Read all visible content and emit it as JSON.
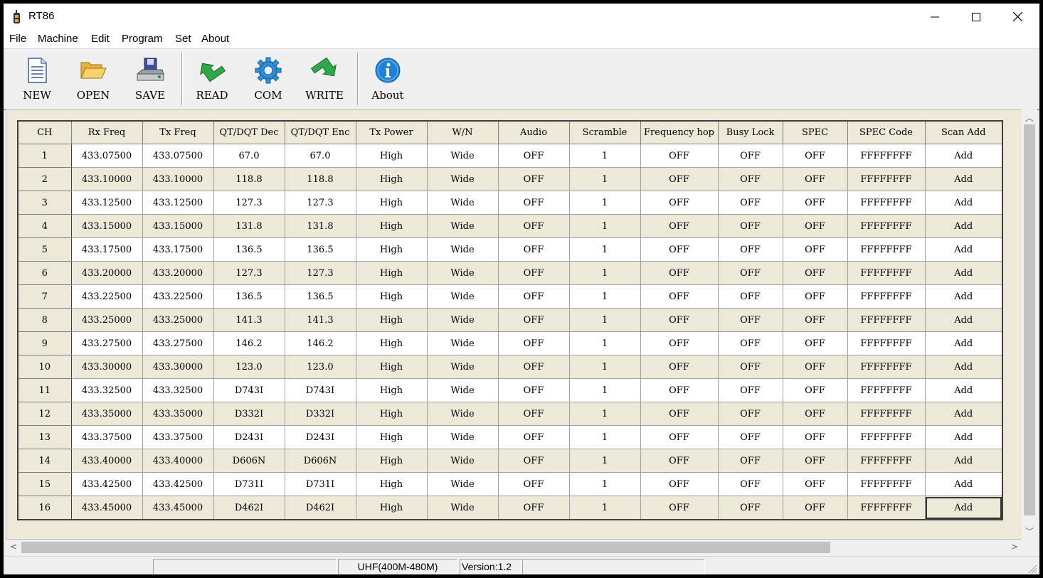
{
  "window": {
    "title": "RT86"
  },
  "menu": [
    "File",
    "Machine",
    "Edit",
    "Program",
    "Set",
    "About"
  ],
  "toolbar": [
    {
      "label": "NEW",
      "icon": "new-document-icon"
    },
    {
      "label": "OPEN",
      "icon": "open-folder-icon"
    },
    {
      "label": "SAVE",
      "icon": "save-disk-icon"
    },
    {
      "label": "READ",
      "icon": "read-arrow-icon"
    },
    {
      "label": "COM",
      "icon": "com-gear-icon"
    },
    {
      "label": "WRITE",
      "icon": "write-arrow-icon"
    },
    {
      "label": "About",
      "icon": "info-icon"
    }
  ],
  "table": {
    "columns": [
      "CH",
      "Rx Freq",
      "Tx Freq",
      "QT/DQT Dec",
      "QT/DQT Enc",
      "Tx Power",
      "W/N",
      "Audio",
      "Scramble",
      "Frequency hop",
      "Busy Lock",
      "SPEC",
      "SPEC Code",
      "Scan Add"
    ],
    "rows": [
      [
        "1",
        "433.07500",
        "433.07500",
        "67.0",
        "67.0",
        "High",
        "Wide",
        "OFF",
        "1",
        "OFF",
        "OFF",
        "OFF",
        "FFFFFFFF",
        "Add"
      ],
      [
        "2",
        "433.10000",
        "433.10000",
        "118.8",
        "118.8",
        "High",
        "Wide",
        "OFF",
        "1",
        "OFF",
        "OFF",
        "OFF",
        "FFFFFFFF",
        "Add"
      ],
      [
        "3",
        "433.12500",
        "433.12500",
        "127.3",
        "127.3",
        "High",
        "Wide",
        "OFF",
        "1",
        "OFF",
        "OFF",
        "OFF",
        "FFFFFFFF",
        "Add"
      ],
      [
        "4",
        "433.15000",
        "433.15000",
        "131.8",
        "131.8",
        "High",
        "Wide",
        "OFF",
        "1",
        "OFF",
        "OFF",
        "OFF",
        "FFFFFFFF",
        "Add"
      ],
      [
        "5",
        "433.17500",
        "433.17500",
        "136.5",
        "136.5",
        "High",
        "Wide",
        "OFF",
        "1",
        "OFF",
        "OFF",
        "OFF",
        "FFFFFFFF",
        "Add"
      ],
      [
        "6",
        "433.20000",
        "433.20000",
        "127.3",
        "127.3",
        "High",
        "Wide",
        "OFF",
        "1",
        "OFF",
        "OFF",
        "OFF",
        "FFFFFFFF",
        "Add"
      ],
      [
        "7",
        "433.22500",
        "433.22500",
        "136.5",
        "136.5",
        "High",
        "Wide",
        "OFF",
        "1",
        "OFF",
        "OFF",
        "OFF",
        "FFFFFFFF",
        "Add"
      ],
      [
        "8",
        "433.25000",
        "433.25000",
        "141.3",
        "141.3",
        "High",
        "Wide",
        "OFF",
        "1",
        "OFF",
        "OFF",
        "OFF",
        "FFFFFFFF",
        "Add"
      ],
      [
        "9",
        "433.27500",
        "433.27500",
        "146.2",
        "146.2",
        "High",
        "Wide",
        "OFF",
        "1",
        "OFF",
        "OFF",
        "OFF",
        "FFFFFFFF",
        "Add"
      ],
      [
        "10",
        "433.30000",
        "433.30000",
        "123.0",
        "123.0",
        "High",
        "Wide",
        "OFF",
        "1",
        "OFF",
        "OFF",
        "OFF",
        "FFFFFFFF",
        "Add"
      ],
      [
        "11",
        "433.32500",
        "433.32500",
        "D743I",
        "D743I",
        "High",
        "Wide",
        "OFF",
        "1",
        "OFF",
        "OFF",
        "OFF",
        "FFFFFFFF",
        "Add"
      ],
      [
        "12",
        "433.35000",
        "433.35000",
        "D332I",
        "D332I",
        "High",
        "Wide",
        "OFF",
        "1",
        "OFF",
        "OFF",
        "OFF",
        "FFFFFFFF",
        "Add"
      ],
      [
        "13",
        "433.37500",
        "433.37500",
        "D243I",
        "D243I",
        "High",
        "Wide",
        "OFF",
        "1",
        "OFF",
        "OFF",
        "OFF",
        "FFFFFFFF",
        "Add"
      ],
      [
        "14",
        "433.40000",
        "433.40000",
        "D606N",
        "D606N",
        "High",
        "Wide",
        "OFF",
        "1",
        "OFF",
        "OFF",
        "OFF",
        "FFFFFFFF",
        "Add"
      ],
      [
        "15",
        "433.42500",
        "433.42500",
        "D731I",
        "D731I",
        "High",
        "Wide",
        "OFF",
        "1",
        "OFF",
        "OFF",
        "OFF",
        "FFFFFFFF",
        "Add"
      ],
      [
        "16",
        "433.45000",
        "433.45000",
        "D462I",
        "D462I",
        "High",
        "Wide",
        "OFF",
        "1",
        "OFF",
        "OFF",
        "OFF",
        "FFFFFFFF",
        "Add"
      ]
    ]
  },
  "status": {
    "band": "UHF(400M-480M)",
    "version": "Version:1.2"
  }
}
